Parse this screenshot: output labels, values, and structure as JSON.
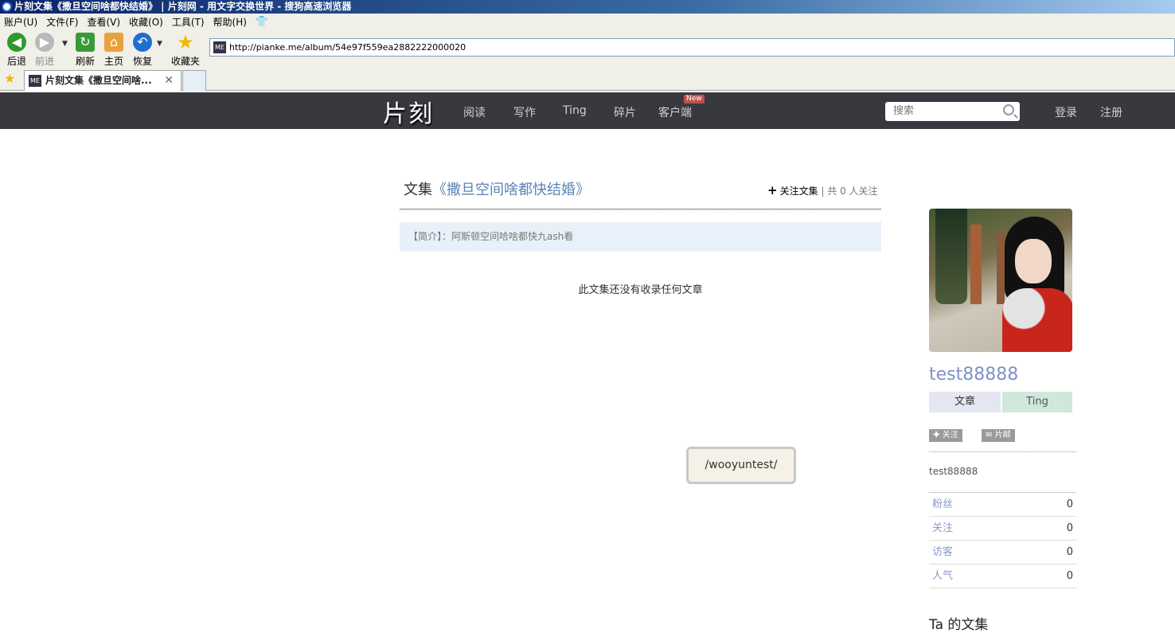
{
  "browser": {
    "title": "片刻文集《撒旦空间啥都快结婚》 | 片刻网 - 用文字交换世界 - 搜狗高速浏览器",
    "menu": [
      "账户(U)",
      "文件(F)",
      "查看(V)",
      "收藏(O)",
      "工具(T)",
      "帮助(H)"
    ],
    "toolbar": {
      "back": "后退",
      "forward": "前进",
      "refresh": "刷新",
      "home": "主页",
      "restore": "恢复",
      "favorites": "收藏夹"
    },
    "address": "http://pianke.me/album/54e97f559ea2882222000020",
    "tab_title": "片刻文集《撒旦空间啥..."
  },
  "site": {
    "brand": "片刻",
    "nav": [
      "阅读",
      "写作",
      "Ting",
      "碎片",
      "客户端"
    ],
    "new_badge": "New",
    "search_placeholder": "搜索",
    "login": "登录",
    "register": "注册"
  },
  "album": {
    "prefix": "文集",
    "name": "《撒旦空间啥都快结婚》",
    "follow_label": "关注文集",
    "follow_count": "| 共 0 人关注",
    "intro": "【简介】：阿斯顿空间哈啥都快九ash看",
    "empty_message": "此文集还没有收录任何文章"
  },
  "popup": {
    "text": "/wooyuntest/"
  },
  "sidebar": {
    "username": "test88888",
    "tab_articles": "文章",
    "tab_ting": "Ting",
    "follow_button": "关注",
    "mail_button": "片邮",
    "bio": "test88888",
    "stats": [
      {
        "label": "粉丝",
        "value": "0"
      },
      {
        "label": "关注",
        "value": "0"
      },
      {
        "label": "访客",
        "value": "0"
      },
      {
        "label": "人气",
        "value": "0"
      }
    ],
    "albums_heading": "Ta 的文集"
  }
}
